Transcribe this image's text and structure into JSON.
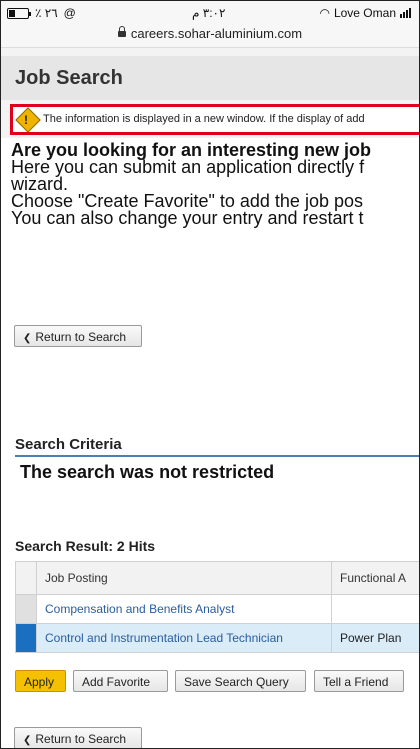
{
  "status_bar": {
    "left_text": "٪ ٢٦",
    "time": "٣:٠٢ م",
    "carrier": "Love Oman"
  },
  "browser": {
    "url": "careers.sohar-aluminium.com"
  },
  "header": {
    "title": "Job Search"
  },
  "notice": {
    "text": "The information is displayed in a new window. If the display of add"
  },
  "intro": {
    "headline": "Are you looking for an interesting new job",
    "line1": "Here you can submit an application directly f",
    "line2": "wizard.",
    "line3": "Choose \"Create Favorite\" to add the job pos",
    "line4": "You can also change your entry and restart t"
  },
  "return_button_label": "Return to Search",
  "search_criteria": {
    "title": "Search Criteria",
    "text": "The search was not restricted"
  },
  "search_result": {
    "title": "Search Result: 2  Hits",
    "columns": [
      "Job Posting",
      "Functional A"
    ],
    "rows": [
      {
        "job": "Compensation and Benefits Analyst",
        "functional": "",
        "selected": false
      },
      {
        "job": "Control and Instrumentation Lead Technician",
        "functional": "Power Plan",
        "selected": true
      }
    ]
  },
  "actions": {
    "apply": "Apply",
    "add_favorite": "Add Favorite",
    "save_search_query": "Save Search Query",
    "tell_a_friend": "Tell a Friend"
  },
  "colors": {
    "notice_border": "#e0001b",
    "apply_button": "#f5c000",
    "link": "#2a5d9f",
    "selected_row": "#d9ecf8",
    "selected_marker": "#1a6fc0"
  }
}
